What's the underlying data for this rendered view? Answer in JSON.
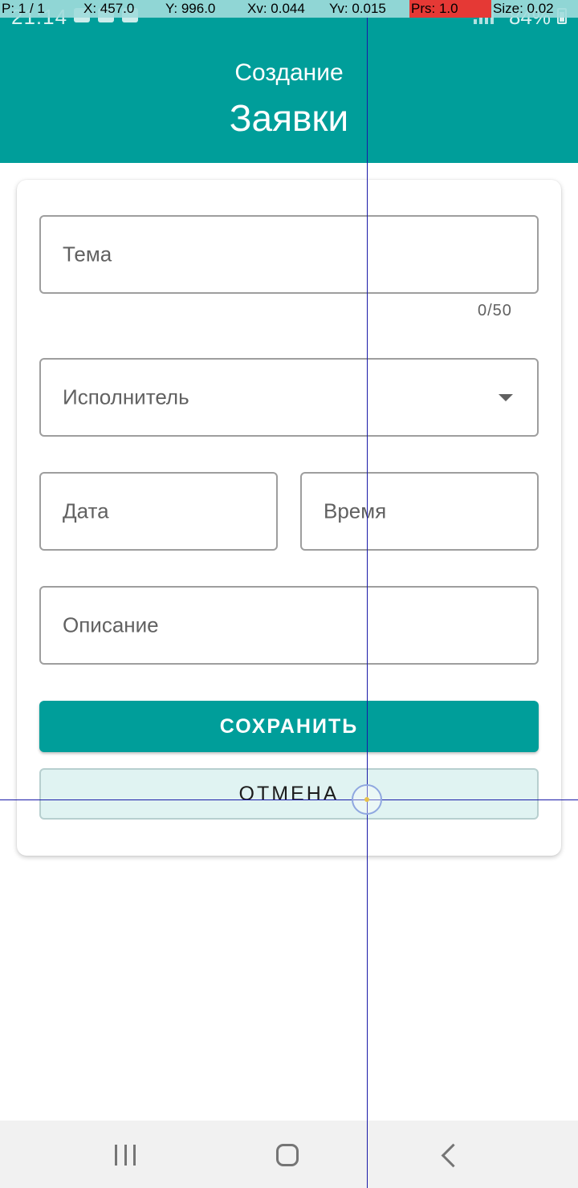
{
  "status_bar": {
    "time": "21:14",
    "battery": "84%"
  },
  "debug_overlay": {
    "pointer": "P: 1 / 1",
    "x": "X: 457.0",
    "y": "Y: 996.0",
    "xv": "Xv: 0.044",
    "yv": "Yv: 0.015",
    "prs": "Prs: 1.0",
    "size": "Size: 0.02"
  },
  "header": {
    "subtitle": "Создание",
    "title": "Заявки"
  },
  "form": {
    "theme": {
      "label": "Тема",
      "counter": "0/50"
    },
    "executor": {
      "label": "Исполнитель"
    },
    "date": {
      "label": "Дата"
    },
    "time": {
      "label": "Время"
    },
    "description": {
      "label": "Описание"
    },
    "save_label": "СОХРАНИТЬ",
    "cancel_label": "ОТМЕНА"
  },
  "colors": {
    "accent": "#009e9a",
    "cancel_bg": "#e0f3f2",
    "debug_pressure": "#e53935"
  },
  "icons": {
    "dropdown": "dropdown-arrow-icon",
    "nav_recent": "recent-apps-icon",
    "nav_home": "home-icon",
    "nav_back": "back-icon"
  }
}
